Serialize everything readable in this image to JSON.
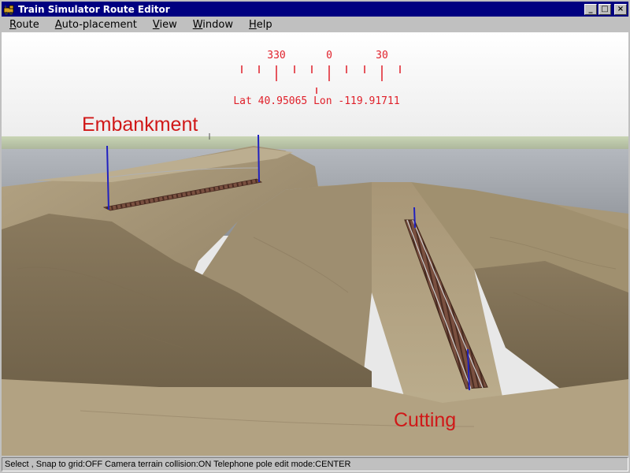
{
  "window": {
    "title": "Train Simulator Route Editor",
    "minimize_symbol": "_",
    "maximize_symbol": "□",
    "close_symbol": "×"
  },
  "menu": [
    {
      "accel": "R",
      "rest": "oute"
    },
    {
      "accel": "A",
      "rest": "uto-placement"
    },
    {
      "accel": "V",
      "rest": "iew"
    },
    {
      "accel": "W",
      "rest": "indow"
    },
    {
      "accel": "H",
      "rest": "elp"
    }
  ],
  "compass": {
    "left_heading": "330",
    "center_heading": "0",
    "right_heading": "30",
    "coordinates": "Lat 40.95065 Lon -119.91711"
  },
  "scene": {
    "label_embankment": "Embankment",
    "label_cutting": "Cutting"
  },
  "status": {
    "text": "Select , Snap to grid:OFF Camera terrain collision:ON Telephone pole edit mode:CENTER"
  },
  "colors": {
    "title_bar": "#000080",
    "annotation_red": "#d01818",
    "compass_red": "#e0202a",
    "terrain": "#a89676",
    "track": "#6a4a3a",
    "pole_marker": "#2020c0"
  }
}
